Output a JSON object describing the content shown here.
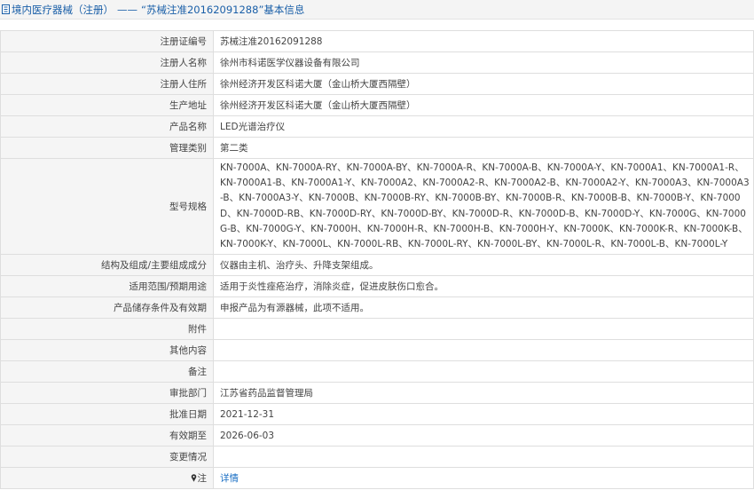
{
  "header": {
    "category": "境内医疗器械（注册）",
    "separator": "——",
    "record": "“苏械注准20162091288”",
    "suffix": "基本信息"
  },
  "rows": [
    {
      "label": "注册证编号",
      "value": "苏械注准20162091288"
    },
    {
      "label": "注册人名称",
      "value": "徐州市科诺医学仪器设备有限公司"
    },
    {
      "label": "注册人住所",
      "value": "徐州经济开发区科诺大厦（金山桥大厦西隔壁）"
    },
    {
      "label": "生产地址",
      "value": "徐州经济开发区科诺大厦（金山桥大厦西隔壁）"
    },
    {
      "label": "产品名称",
      "value": "LED光谱治疗仪"
    },
    {
      "label": "管理类别",
      "value": "第二类"
    },
    {
      "label": "型号规格",
      "value": "KN-7000A、KN-7000A-RY、KN-7000A-BY、KN-7000A-R、KN-7000A-B、KN-7000A-Y、KN-7000A1、KN-7000A1-R、KN-7000A1-B、KN-7000A1-Y、KN-7000A2、KN-7000A2-R、KN-7000A2-B、KN-7000A2-Y、KN-7000A3、KN-7000A3-B、KN-7000A3-Y、KN-7000B、KN-7000B-RY、KN-7000B-BY、KN-7000B-R、KN-7000B-B、KN-7000B-Y、KN-7000D、KN-7000D-RB、KN-7000D-RY、KN-7000D-BY、KN-7000D-R、KN-7000D-B、KN-7000D-Y、KN-7000G、KN-7000G-B、KN-7000G-Y、KN-7000H、KN-7000H-R、KN-7000H-B、KN-7000H-Y、KN-7000K、KN-7000K-R、KN-7000K-B、KN-7000K-Y、KN-7000L、KN-7000L-RB、KN-7000L-RY、KN-7000L-BY、KN-7000L-R、KN-7000L-B、KN-7000L-Y"
    },
    {
      "label": "结构及组成/主要组成成分",
      "value": "仪器由主机、治疗头、升降支架组成。"
    },
    {
      "label": "适用范围/预期用途",
      "value": "适用于炎性痤疮治疗，消除炎症，促进皮肤伤口愈合。"
    },
    {
      "label": "产品储存条件及有效期",
      "value": "申报产品为有源器械，此项不适用。"
    },
    {
      "label": "附件",
      "value": ""
    },
    {
      "label": "其他内容",
      "value": ""
    },
    {
      "label": "备注",
      "value": ""
    },
    {
      "label": "审批部门",
      "value": "江苏省药品监督管理局"
    },
    {
      "label": "批准日期",
      "value": "2021-12-31"
    },
    {
      "label": "有效期至",
      "value": "2026-06-03"
    },
    {
      "label": "变更情况",
      "value": ""
    },
    {
      "label": "注",
      "value": "详情"
    }
  ]
}
